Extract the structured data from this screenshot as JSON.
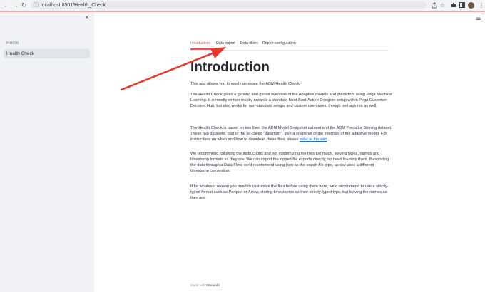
{
  "browser": {
    "url": "localhost:8501/Health_Check",
    "nav_back": "←",
    "nav_forward": "→",
    "reload": "↻",
    "lock": "ⓘ"
  },
  "sidebar": {
    "close": "×",
    "items": [
      {
        "label": "Home"
      },
      {
        "label": "Health Check"
      }
    ]
  },
  "tabs": [
    {
      "label": "Introduction",
      "active": true
    },
    {
      "label": "Data import"
    },
    {
      "label": "Data filters"
    },
    {
      "label": "Report configuration"
    }
  ],
  "content": {
    "title": "Introduction",
    "p1": "This app allows you to easily generate the ADM Health Check.",
    "p2": "The Health Check gives a generic and global overview of the Adaptive models and predictors using Pega Machine Learning. It is mostly written mostly towards a standard Next-Best-Action Designer setup within Pega Customer Decision Hub, but also works for non-standard setups and custom use-cases, though perhaps not as well.",
    "p3_text": "The Health Check is based on two files: the ADM Model Snapshot dataset and the ADM Predictor Binning dataset. These two datasets, part of the so-called \"datamart\", give a snapshot of the internals of the adaptive model. For instructions on when and how to download these files, please ",
    "p3_link": "refer to the wiki",
    "p4": "We recommend following the instructions and not customizing the files too much, leaving types, names and timestamp formats as they are. We can import the zipped file exports directly, no need to unzip them. If exporting the data through a Data Flow, we'd recommend using json as the export file type, as csv uses a different timestamp convention.",
    "p5": "If for whatever reason you need to customize the files before using them here, we'd recommend to use a strictly-typed format such as Parquet or Arrow, storing timestamps as their strictly-typed type, but leaving the names as they are."
  },
  "footer": {
    "prefix": "Made with ",
    "brand": "Streamlit"
  },
  "colors": {
    "accent": "#ff4b4b",
    "arrow": "#e8372b",
    "sidebar_bg": "#f0f2f6",
    "link": "#1f6fd1"
  },
  "icons": [
    "back-arrow-icon",
    "forward-arrow-icon",
    "reload-icon",
    "info-icon",
    "share-icon",
    "star-icon",
    "extensions-icon",
    "split-view-icon",
    "profile-avatar",
    "menu-dots-icon",
    "close-icon",
    "hamburger-icon"
  ]
}
